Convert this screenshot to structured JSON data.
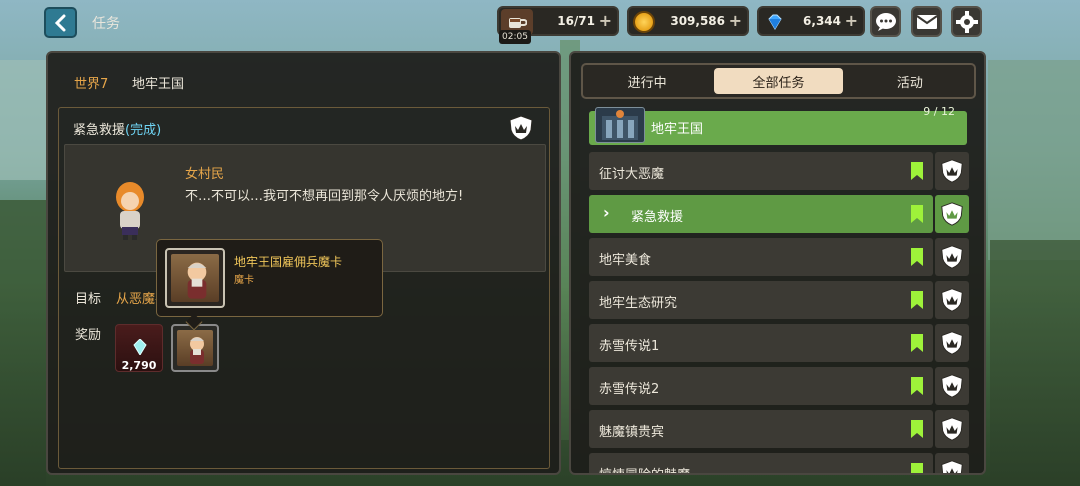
{
  "header": {
    "title": "任务",
    "stamina": {
      "value": "16/71",
      "timer": "02:05"
    },
    "gold": {
      "value": "309,586"
    },
    "gems": {
      "value": "6,344"
    },
    "plus": "+"
  },
  "left": {
    "world": "世界7",
    "region": "地牢王国",
    "quest_title": "紧急救援",
    "quest_status": "(完成)",
    "npc_name": "女村民",
    "npc_line": "不…不可以…我可不想再回到那令人厌烦的地方!",
    "goal_label": "目标",
    "goal_text": "从恶魔手",
    "reward_label": "奖励",
    "reward_gem_count": "2,790",
    "tooltip": {
      "name": "地牢王国雇佣兵魔卡",
      "type": "魔卡"
    }
  },
  "right": {
    "tabs": [
      {
        "label": "进行中",
        "active": false
      },
      {
        "label": "全部任务",
        "active": true
      },
      {
        "label": "活动",
        "active": false
      }
    ],
    "group": {
      "name": "地牢王国",
      "progress": "9 / 12"
    },
    "quests": [
      {
        "name": "征讨大恶魔",
        "selected": false
      },
      {
        "name": "紧急救援",
        "selected": true
      },
      {
        "name": "地牢美食",
        "selected": false
      },
      {
        "name": "地牢生态研究",
        "selected": false
      },
      {
        "name": "赤雪传说1",
        "selected": false
      },
      {
        "name": "赤雪传说2",
        "selected": false
      },
      {
        "name": "魅魔镇贵宾",
        "selected": false
      },
      {
        "name": "惊悚冒险的魅魔",
        "selected": false
      }
    ]
  },
  "colors": {
    "accent_orange": "#e7a64a",
    "selected_green": "#5f9a44",
    "flag_green": "#9ef23a",
    "status_blue": "#6fd4f4"
  }
}
